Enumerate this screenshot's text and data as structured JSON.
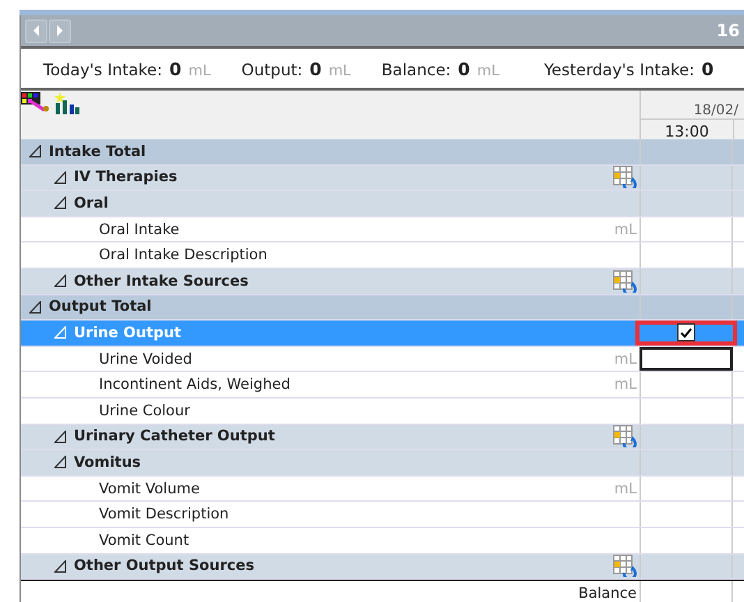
{
  "header": {
    "date_fragment": "16"
  },
  "summary": [
    {
      "label": "Today's Intake:",
      "value": "0",
      "unit": "mL"
    },
    {
      "label": "Output:",
      "value": "0",
      "unit": "mL"
    },
    {
      "label": "Balance:",
      "value": "0",
      "unit": "mL"
    },
    {
      "label": "Yesterday's Intake:",
      "value": "0"
    }
  ],
  "column": {
    "date": "18/02/",
    "time": "13:00"
  },
  "rows": [
    {
      "kind": "group",
      "label": "Intake Total",
      "expanded": true,
      "children": [
        {
          "kind": "subgroup",
          "label": "IV Therapies",
          "expanded": true,
          "grid_icon": true
        },
        {
          "kind": "subgroup",
          "label": "Oral",
          "expanded": true,
          "children": [
            {
              "kind": "item",
              "label": "Oral Intake",
              "unit": "mL"
            },
            {
              "kind": "item",
              "label": "Oral Intake Description"
            }
          ]
        },
        {
          "kind": "subgroup",
          "label": "Other Intake Sources",
          "expanded": true,
          "grid_icon": true
        }
      ]
    },
    {
      "kind": "group",
      "label": "Output Total",
      "expanded": true,
      "children": [
        {
          "kind": "subgroup",
          "label": "Urine Output",
          "expanded": true,
          "selected": true,
          "checked": true,
          "children": [
            {
              "kind": "item",
              "label": "Urine Voided",
              "unit": "mL",
              "focused": true
            },
            {
              "kind": "item",
              "label": "Incontinent Aids, Weighed",
              "unit": "mL"
            },
            {
              "kind": "item",
              "label": "Urine Colour"
            }
          ]
        },
        {
          "kind": "subgroup",
          "label": "Urinary Catheter Output",
          "expanded": true,
          "grid_icon": true
        },
        {
          "kind": "subgroup",
          "label": "Vomitus",
          "expanded": true,
          "children": [
            {
              "kind": "item",
              "label": "Vomit Volume",
              "unit": "mL"
            },
            {
              "kind": "item",
              "label": "Vomit Description"
            },
            {
              "kind": "item",
              "label": "Vomit Count"
            }
          ]
        },
        {
          "kind": "subgroup",
          "label": "Other Output Sources",
          "expanded": true,
          "grid_icon": true
        }
      ]
    }
  ],
  "footer": {
    "label": "Balance"
  }
}
